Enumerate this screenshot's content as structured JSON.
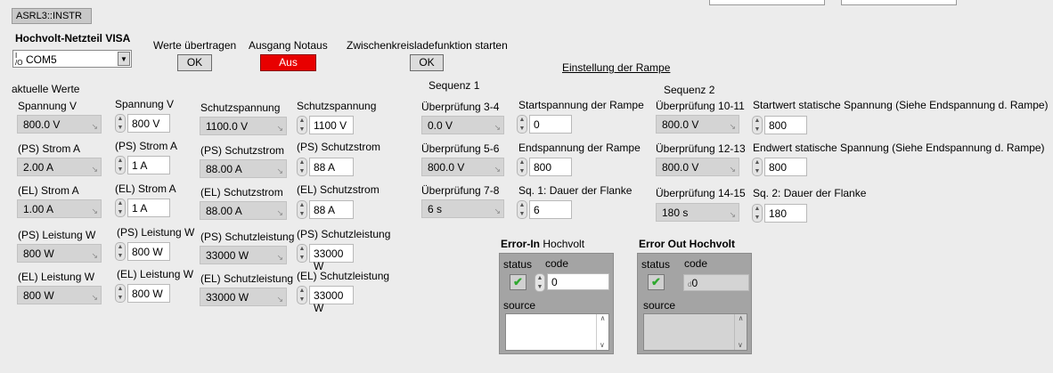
{
  "resource": "ASRL3::INSTR",
  "visa": {
    "title": "Hochvolt-Netzteil VISA",
    "value": "COM5",
    "io_glyph": "I/O"
  },
  "buttons": {
    "werte_label": "Werte übertragen",
    "werte_btn": "OK",
    "notaus_label": "Ausgang Notaus",
    "notaus_btn": "Aus",
    "zk_label": "Zwischenkreisladefunktion starten",
    "zk_btn": "OK"
  },
  "rampe_link": "Einstellung der Rampe",
  "col1": {
    "header": "aktuelle Werte",
    "items": [
      {
        "label": "Spannung V",
        "value": "800.0 V"
      },
      {
        "label": "(PS) Strom A",
        "value": "2.00 A"
      },
      {
        "label": "(EL) Strom A",
        "value": "1.00 A"
      },
      {
        "label": "(PS) Leistung W",
        "value": "800 W"
      },
      {
        "label": "(EL) Leistung W",
        "value": "800 W"
      }
    ]
  },
  "col2": {
    "items": [
      {
        "label": "Spannung V",
        "value": "800 V"
      },
      {
        "label": "(PS) Strom A",
        "value": "1 A"
      },
      {
        "label": "(EL) Strom A",
        "value": "1 A"
      },
      {
        "label": "(PS) Leistung W",
        "value": "800 W"
      },
      {
        "label": "(EL) Leistung W",
        "value": "800 W"
      }
    ]
  },
  "col3": {
    "items": [
      {
        "label": "Schutzspannung",
        "value": "1100.0 V"
      },
      {
        "label": "(PS) Schutzstrom",
        "value": "88.00 A"
      },
      {
        "label": "(EL) Schutzstrom",
        "value": "88.00 A"
      },
      {
        "label": "(PS) Schutzleistung",
        "value": "33000 W"
      },
      {
        "label": "(EL) Schutzleistung",
        "value": "33000 W"
      }
    ]
  },
  "col4": {
    "items": [
      {
        "label": "Schutzspannung",
        "value": "1100 V"
      },
      {
        "label": "(PS) Schutzstrom",
        "value": "88 A"
      },
      {
        "label": "(EL) Schutzstrom",
        "value": "88 A"
      },
      {
        "label": "(PS) Schutzleistung",
        "value": "33000 W"
      },
      {
        "label": "(EL) Schutzleistung",
        "value": "33000 W"
      }
    ]
  },
  "seq1": {
    "title": "Sequenz 1",
    "checks": [
      {
        "label": "Überprüfung 3-4",
        "value": "0.0 V"
      },
      {
        "label": "Überprüfung 5-6",
        "value": "800.0 V"
      },
      {
        "label": "Überprüfung 7-8",
        "value": "6 s"
      }
    ],
    "controls": [
      {
        "label": "Startspannung der Rampe",
        "value": "0"
      },
      {
        "label": "Endspannung der Rampe",
        "value": "800"
      },
      {
        "label": "Sq. 1: Dauer der Flanke",
        "value": "6"
      }
    ]
  },
  "seq2": {
    "title": "Sequenz 2",
    "checks": [
      {
        "label": "Überprüfung 10-11",
        "value": "800.0 V"
      },
      {
        "label": "Überprüfung 12-13",
        "value": "800.0 V"
      },
      {
        "label": "Überprüfung 14-15",
        "value": "180 s"
      }
    ],
    "controls": [
      {
        "label": "Startwert statische Spannung (Siehe Endspannung d. Rampe)",
        "value": "800"
      },
      {
        "label": "Endwert statische Spannung (Siehe Endspannung d. Rampe)",
        "value": "800"
      },
      {
        "label": "Sq. 2: Dauer der Flanke",
        "value": "180"
      }
    ]
  },
  "error_in": {
    "title_bold": "Error-In",
    "title_rest": " Hochvolt",
    "status": "status",
    "code": "code",
    "code_value": "0",
    "source": "source"
  },
  "error_out": {
    "title": "Error Out Hochvolt",
    "status": "status",
    "code": "code",
    "code_value": "0",
    "source": "source"
  },
  "colors": {
    "notaus": "#e80000",
    "check": "#2fa82f"
  }
}
